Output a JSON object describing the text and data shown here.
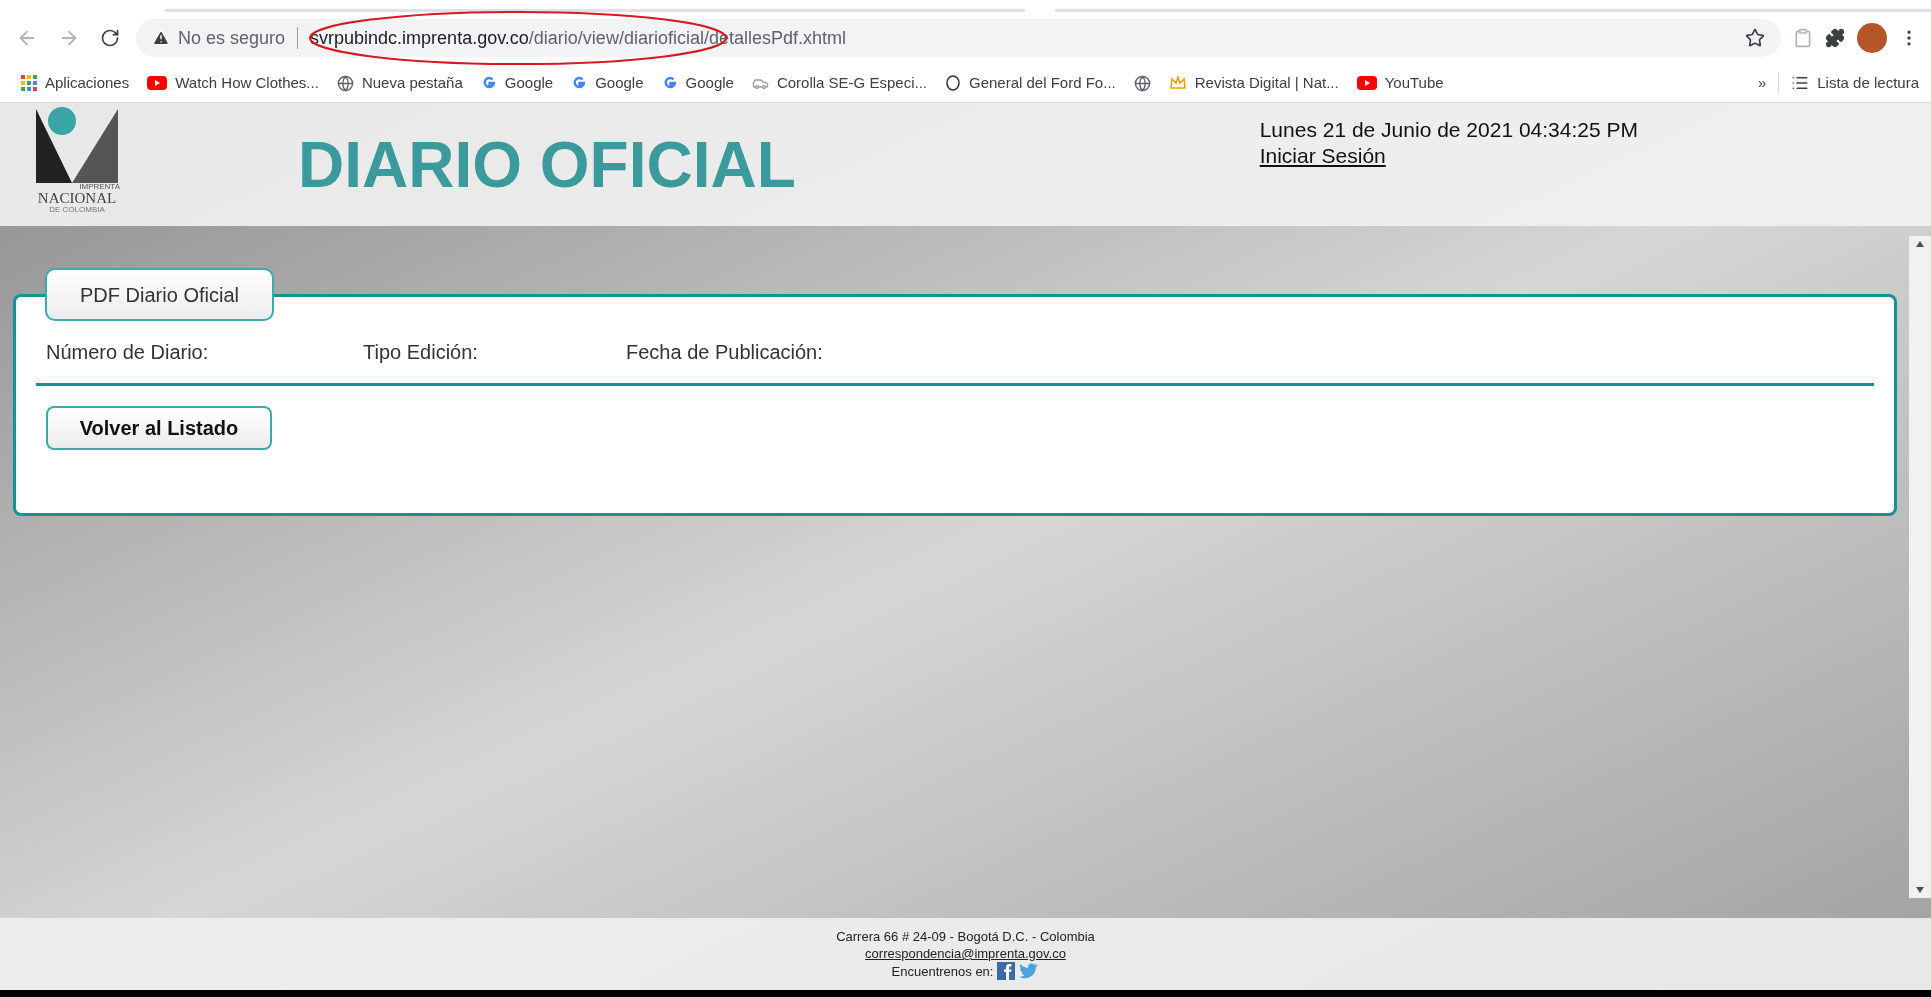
{
  "browser": {
    "security": "No es seguro",
    "url_host": "svrpubindc.imprenta.gov.co",
    "url_path": "/diario/view/diarioficial/detallesPdf.xhtml",
    "bookmarks": [
      {
        "kind": "apps",
        "label": "Aplicaciones"
      },
      {
        "kind": "youtube",
        "label": "Watch How Clothes..."
      },
      {
        "kind": "globe",
        "label": "Nueva pestaña"
      },
      {
        "kind": "google",
        "label": "Google"
      },
      {
        "kind": "google",
        "label": "Google"
      },
      {
        "kind": "google",
        "label": "Google"
      },
      {
        "kind": "car",
        "label": "Corolla SE-G Especi..."
      },
      {
        "kind": "ford",
        "label": "General del Ford Fo..."
      },
      {
        "kind": "globe"
      },
      {
        "kind": "revista",
        "label": "Revista Digital | Nat..."
      },
      {
        "kind": "youtube",
        "label": "YouTube"
      }
    ],
    "overflow": "»",
    "reading_list": "Lista de lectura"
  },
  "header": {
    "logo_top": "IMPRENTA",
    "logo_name": "NACIONAL",
    "logo_sub": "DE COLOMBIA",
    "title": "DIARIO OFICIAL",
    "datetime": "Lunes 21 de Junio de 2021 04:34:25 PM",
    "login": "Iniciar Sesión"
  },
  "panel": {
    "legend": "PDF Diario Oficial",
    "fields": [
      "Número de Diario:",
      "Tipo Edición:",
      "Fecha de Publicación:"
    ],
    "button": "Volver al Listado"
  },
  "footer": {
    "address": "Carrera 66 # 24-09 - Bogotá D.C. - Colombia",
    "email": "correspondencia@imprenta.gov.co",
    "social": "Encuentrenos en:"
  }
}
